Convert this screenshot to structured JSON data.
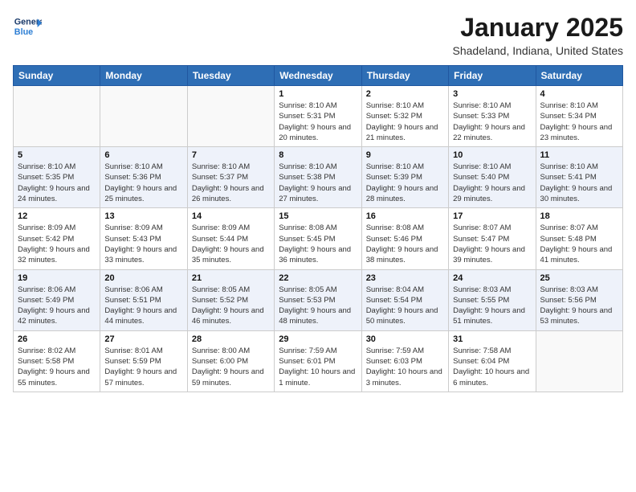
{
  "header": {
    "logo_line1": "General",
    "logo_line2": "Blue",
    "month": "January 2025",
    "location": "Shadeland, Indiana, United States"
  },
  "weekdays": [
    "Sunday",
    "Monday",
    "Tuesday",
    "Wednesday",
    "Thursday",
    "Friday",
    "Saturday"
  ],
  "weeks": [
    [
      {
        "day": "",
        "sunrise": "",
        "sunset": "",
        "daylight": ""
      },
      {
        "day": "",
        "sunrise": "",
        "sunset": "",
        "daylight": ""
      },
      {
        "day": "",
        "sunrise": "",
        "sunset": "",
        "daylight": ""
      },
      {
        "day": "1",
        "sunrise": "Sunrise: 8:10 AM",
        "sunset": "Sunset: 5:31 PM",
        "daylight": "Daylight: 9 hours and 20 minutes."
      },
      {
        "day": "2",
        "sunrise": "Sunrise: 8:10 AM",
        "sunset": "Sunset: 5:32 PM",
        "daylight": "Daylight: 9 hours and 21 minutes."
      },
      {
        "day": "3",
        "sunrise": "Sunrise: 8:10 AM",
        "sunset": "Sunset: 5:33 PM",
        "daylight": "Daylight: 9 hours and 22 minutes."
      },
      {
        "day": "4",
        "sunrise": "Sunrise: 8:10 AM",
        "sunset": "Sunset: 5:34 PM",
        "daylight": "Daylight: 9 hours and 23 minutes."
      }
    ],
    [
      {
        "day": "5",
        "sunrise": "Sunrise: 8:10 AM",
        "sunset": "Sunset: 5:35 PM",
        "daylight": "Daylight: 9 hours and 24 minutes."
      },
      {
        "day": "6",
        "sunrise": "Sunrise: 8:10 AM",
        "sunset": "Sunset: 5:36 PM",
        "daylight": "Daylight: 9 hours and 25 minutes."
      },
      {
        "day": "7",
        "sunrise": "Sunrise: 8:10 AM",
        "sunset": "Sunset: 5:37 PM",
        "daylight": "Daylight: 9 hours and 26 minutes."
      },
      {
        "day": "8",
        "sunrise": "Sunrise: 8:10 AM",
        "sunset": "Sunset: 5:38 PM",
        "daylight": "Daylight: 9 hours and 27 minutes."
      },
      {
        "day": "9",
        "sunrise": "Sunrise: 8:10 AM",
        "sunset": "Sunset: 5:39 PM",
        "daylight": "Daylight: 9 hours and 28 minutes."
      },
      {
        "day": "10",
        "sunrise": "Sunrise: 8:10 AM",
        "sunset": "Sunset: 5:40 PM",
        "daylight": "Daylight: 9 hours and 29 minutes."
      },
      {
        "day": "11",
        "sunrise": "Sunrise: 8:10 AM",
        "sunset": "Sunset: 5:41 PM",
        "daylight": "Daylight: 9 hours and 30 minutes."
      }
    ],
    [
      {
        "day": "12",
        "sunrise": "Sunrise: 8:09 AM",
        "sunset": "Sunset: 5:42 PM",
        "daylight": "Daylight: 9 hours and 32 minutes."
      },
      {
        "day": "13",
        "sunrise": "Sunrise: 8:09 AM",
        "sunset": "Sunset: 5:43 PM",
        "daylight": "Daylight: 9 hours and 33 minutes."
      },
      {
        "day": "14",
        "sunrise": "Sunrise: 8:09 AM",
        "sunset": "Sunset: 5:44 PM",
        "daylight": "Daylight: 9 hours and 35 minutes."
      },
      {
        "day": "15",
        "sunrise": "Sunrise: 8:08 AM",
        "sunset": "Sunset: 5:45 PM",
        "daylight": "Daylight: 9 hours and 36 minutes."
      },
      {
        "day": "16",
        "sunrise": "Sunrise: 8:08 AM",
        "sunset": "Sunset: 5:46 PM",
        "daylight": "Daylight: 9 hours and 38 minutes."
      },
      {
        "day": "17",
        "sunrise": "Sunrise: 8:07 AM",
        "sunset": "Sunset: 5:47 PM",
        "daylight": "Daylight: 9 hours and 39 minutes."
      },
      {
        "day": "18",
        "sunrise": "Sunrise: 8:07 AM",
        "sunset": "Sunset: 5:48 PM",
        "daylight": "Daylight: 9 hours and 41 minutes."
      }
    ],
    [
      {
        "day": "19",
        "sunrise": "Sunrise: 8:06 AM",
        "sunset": "Sunset: 5:49 PM",
        "daylight": "Daylight: 9 hours and 42 minutes."
      },
      {
        "day": "20",
        "sunrise": "Sunrise: 8:06 AM",
        "sunset": "Sunset: 5:51 PM",
        "daylight": "Daylight: 9 hours and 44 minutes."
      },
      {
        "day": "21",
        "sunrise": "Sunrise: 8:05 AM",
        "sunset": "Sunset: 5:52 PM",
        "daylight": "Daylight: 9 hours and 46 minutes."
      },
      {
        "day": "22",
        "sunrise": "Sunrise: 8:05 AM",
        "sunset": "Sunset: 5:53 PM",
        "daylight": "Daylight: 9 hours and 48 minutes."
      },
      {
        "day": "23",
        "sunrise": "Sunrise: 8:04 AM",
        "sunset": "Sunset: 5:54 PM",
        "daylight": "Daylight: 9 hours and 50 minutes."
      },
      {
        "day": "24",
        "sunrise": "Sunrise: 8:03 AM",
        "sunset": "Sunset: 5:55 PM",
        "daylight": "Daylight: 9 hours and 51 minutes."
      },
      {
        "day": "25",
        "sunrise": "Sunrise: 8:03 AM",
        "sunset": "Sunset: 5:56 PM",
        "daylight": "Daylight: 9 hours and 53 minutes."
      }
    ],
    [
      {
        "day": "26",
        "sunrise": "Sunrise: 8:02 AM",
        "sunset": "Sunset: 5:58 PM",
        "daylight": "Daylight: 9 hours and 55 minutes."
      },
      {
        "day": "27",
        "sunrise": "Sunrise: 8:01 AM",
        "sunset": "Sunset: 5:59 PM",
        "daylight": "Daylight: 9 hours and 57 minutes."
      },
      {
        "day": "28",
        "sunrise": "Sunrise: 8:00 AM",
        "sunset": "Sunset: 6:00 PM",
        "daylight": "Daylight: 9 hours and 59 minutes."
      },
      {
        "day": "29",
        "sunrise": "Sunrise: 7:59 AM",
        "sunset": "Sunset: 6:01 PM",
        "daylight": "Daylight: 10 hours and 1 minute."
      },
      {
        "day": "30",
        "sunrise": "Sunrise: 7:59 AM",
        "sunset": "Sunset: 6:03 PM",
        "daylight": "Daylight: 10 hours and 3 minutes."
      },
      {
        "day": "31",
        "sunrise": "Sunrise: 7:58 AM",
        "sunset": "Sunset: 6:04 PM",
        "daylight": "Daylight: 10 hours and 6 minutes."
      },
      {
        "day": "",
        "sunrise": "",
        "sunset": "",
        "daylight": ""
      }
    ]
  ]
}
